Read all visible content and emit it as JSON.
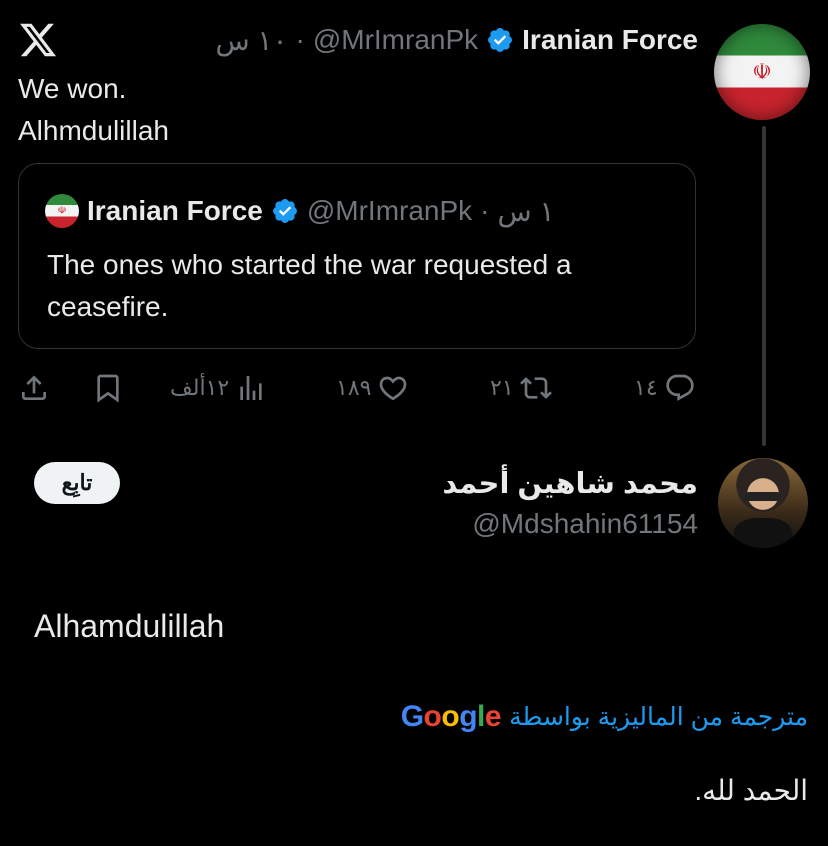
{
  "top": {
    "logo": "x-logo",
    "author_name": "Iranian Force",
    "author_handle": "@MrImranPk",
    "time": "١٠ س",
    "separator": "·"
  },
  "tweet": {
    "text": "We won.\nAlhmdulillah"
  },
  "quote": {
    "author_name": "Iranian Force",
    "author_handle": "@MrImranPk",
    "time": "١ س",
    "separator": "·",
    "text": "The ones who started the war requested a ceasefire."
  },
  "actions": {
    "replies": "١٤",
    "reposts": "٢١",
    "likes": "١٨٩",
    "views": "١٢ألف"
  },
  "reply_user": {
    "name": "محمد شاهين أحمد",
    "handle": "@Mdshahin61154",
    "follow_label": "تابِع"
  },
  "reply": {
    "text": "Alhamdulillah",
    "translated_by_label": "مترجمة من الماليزية بواسطة",
    "translator": "Google",
    "translation": "الحمد لله."
  },
  "colors": {
    "background": "#000000",
    "text": "#e7e9ea",
    "muted": "#71767b",
    "verified": "#1d9bf0",
    "link": "#1d9bf0"
  }
}
